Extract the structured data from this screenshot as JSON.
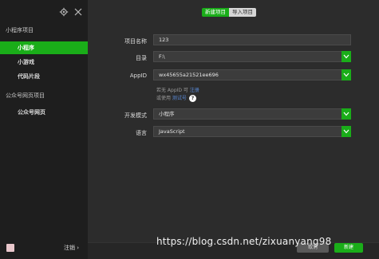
{
  "sidebar": {
    "sections": [
      {
        "title": "小程序项目",
        "items": [
          "小程序",
          "小游戏",
          "代码片段"
        ]
      },
      {
        "title": "公众号网页项目",
        "items": [
          "公众号网页"
        ]
      }
    ],
    "logout_label": "注销 ›",
    "icons": [
      "gear-icon",
      "close-icon"
    ]
  },
  "tabs": {
    "new_label": "新建项目",
    "import_label": "导入项目"
  },
  "form": {
    "name_label": "项目名称",
    "name_value": "123",
    "dir_label": "目录",
    "dir_value": "F:\\",
    "appid_label": "AppID",
    "appid_value": "wx45655a21521ee696",
    "hint_line1_prefix": "若无 AppID 可 ",
    "hint_line1_link": "注册",
    "hint_line2_prefix": "或使用 ",
    "hint_line2_link": "测试号",
    "help_icon_text": "?",
    "mode_label": "开发模式",
    "mode_value": "小程序",
    "lang_label": "语言",
    "lang_value": "JavaScript"
  },
  "buttons": {
    "cancel_label": "取消",
    "create_label": "新建"
  },
  "watermark": "https://blog.csdn.net/zixuanyang98",
  "colors": {
    "accent": "#1aad19",
    "sidebar_bg": "#1e1e1e",
    "main_bg": "#2c2c2c",
    "link": "#5b8bd8"
  }
}
